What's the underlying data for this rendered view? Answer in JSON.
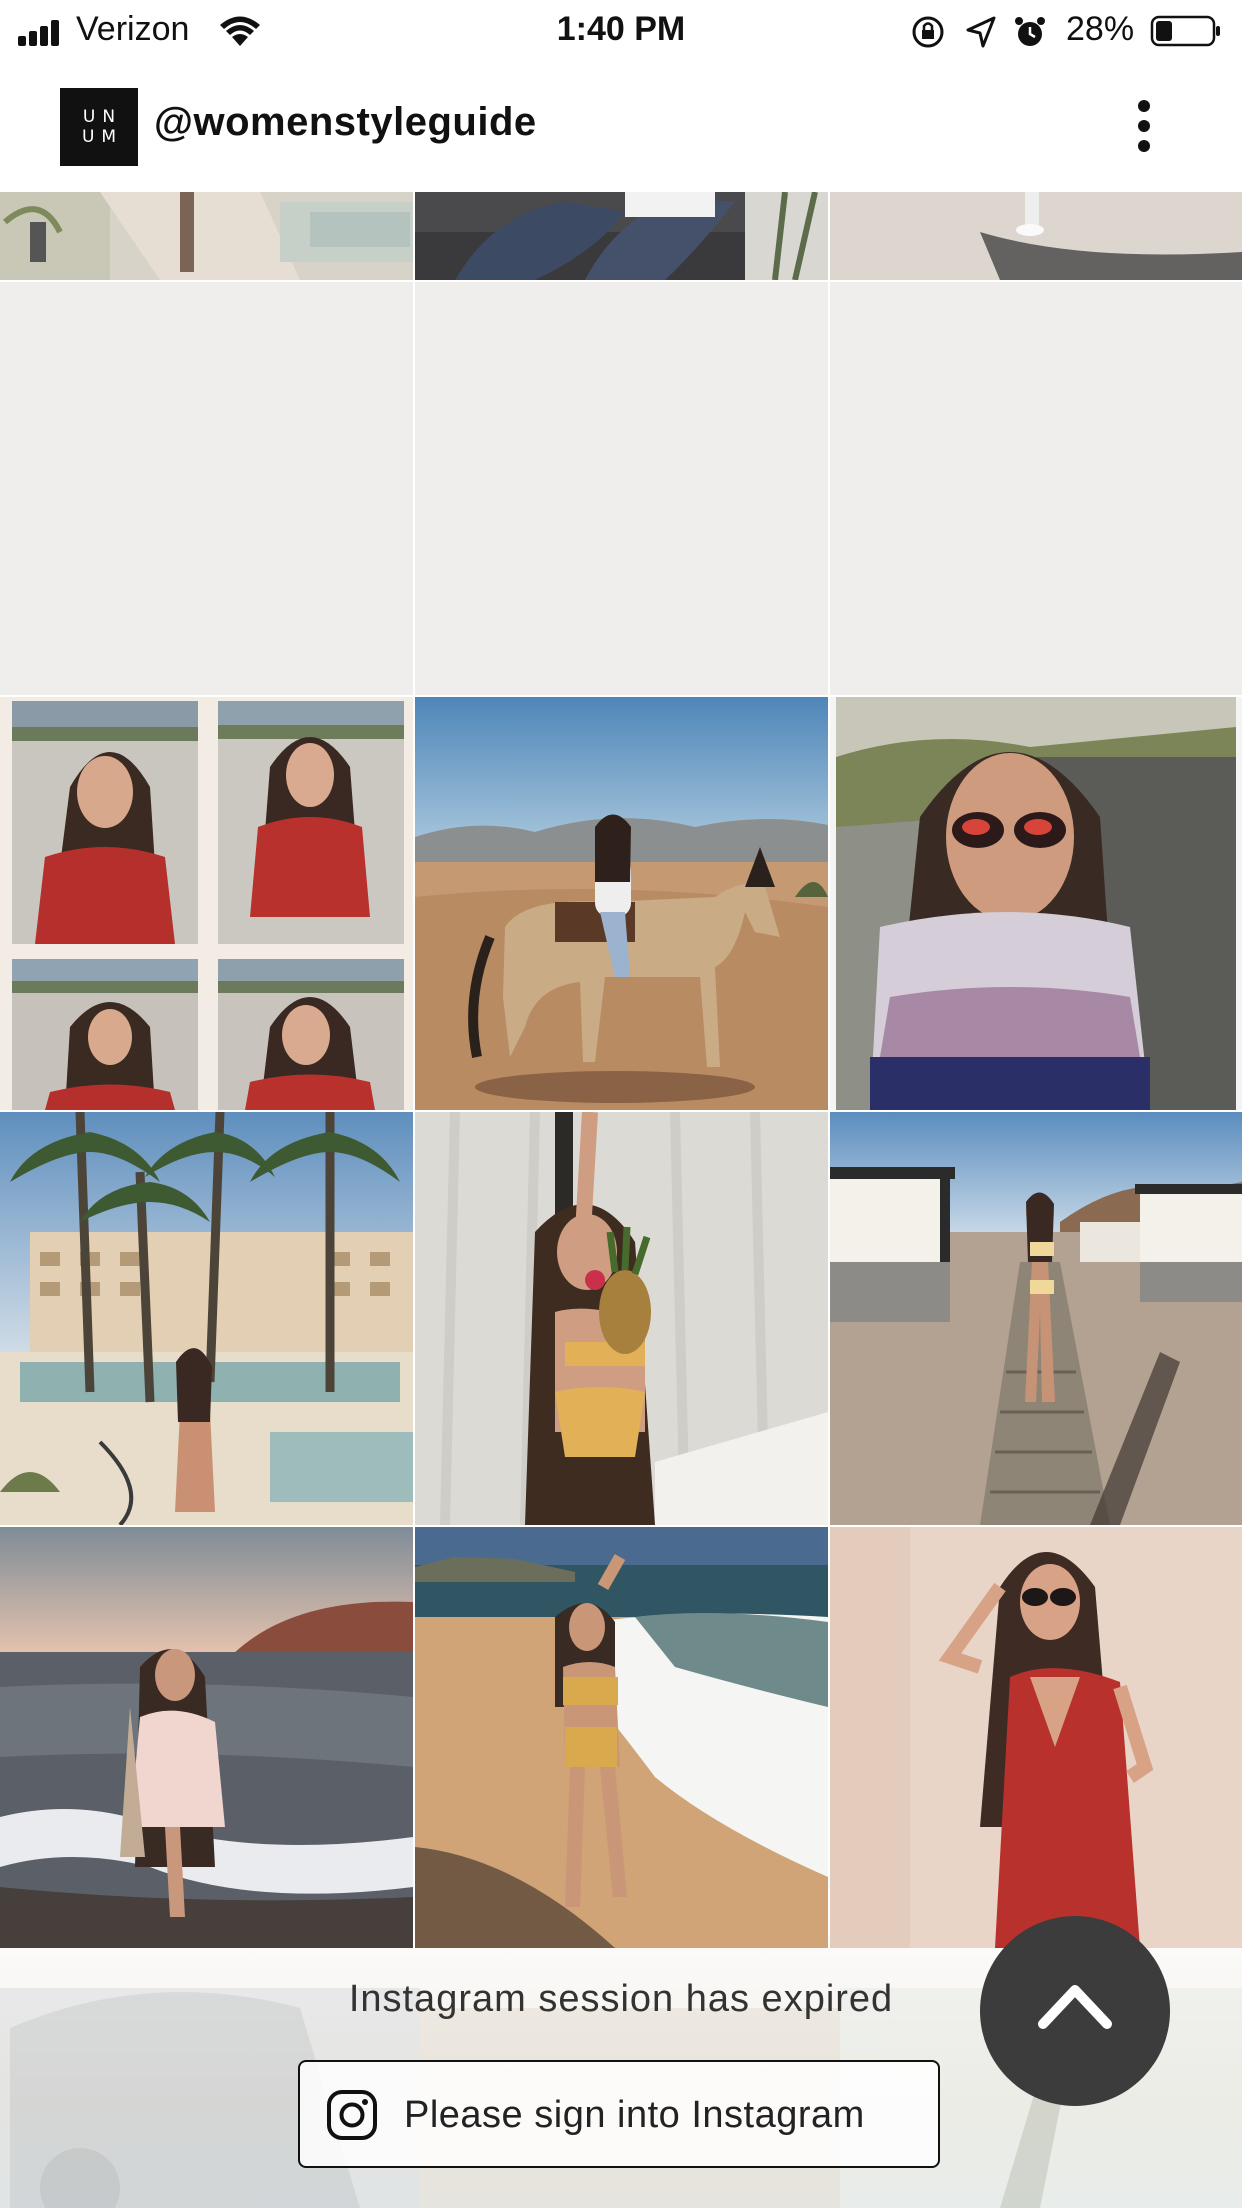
{
  "status_bar": {
    "carrier": "Verizon",
    "time": "1:40 PM",
    "battery": "28%",
    "icons": [
      "signal-icon",
      "wifi-icon",
      "orientation-lock-icon",
      "location-icon",
      "alarm-icon",
      "battery-icon"
    ]
  },
  "header": {
    "logo_line1": "UN",
    "logo_line2": "UM",
    "username": "@womenstyleguide",
    "menu_icon": "more-vertical-icon"
  },
  "grid": {
    "tiles": [
      {
        "name": "tile-resort-pool-partial"
      },
      {
        "name": "tile-jeans-couch-partial"
      },
      {
        "name": "tile-sand-shadow-partial"
      },
      {
        "name": "tile-placeholder-1"
      },
      {
        "name": "tile-placeholder-2"
      },
      {
        "name": "tile-placeholder-3"
      },
      {
        "name": "tile-red-dress-collage"
      },
      {
        "name": "tile-horse-desert"
      },
      {
        "name": "tile-sunglasses-road"
      },
      {
        "name": "tile-palm-resort-pool"
      },
      {
        "name": "tile-pineapple-curtain"
      },
      {
        "name": "tile-cabana-boardwalk"
      },
      {
        "name": "tile-sunset-beach-wade"
      },
      {
        "name": "tile-beach-waves"
      },
      {
        "name": "tile-red-dress-wall"
      }
    ]
  },
  "footer": {
    "expired_text": "Instagram session has expired",
    "signin_label": "Please sign into Instagram",
    "signin_icon": "instagram-icon",
    "scroll_top_icon": "chevron-up-icon"
  },
  "colors": {
    "background": "#ffffff",
    "placeholder": "#efeeec",
    "fab": "#3c3c3c",
    "text": "#111111"
  }
}
